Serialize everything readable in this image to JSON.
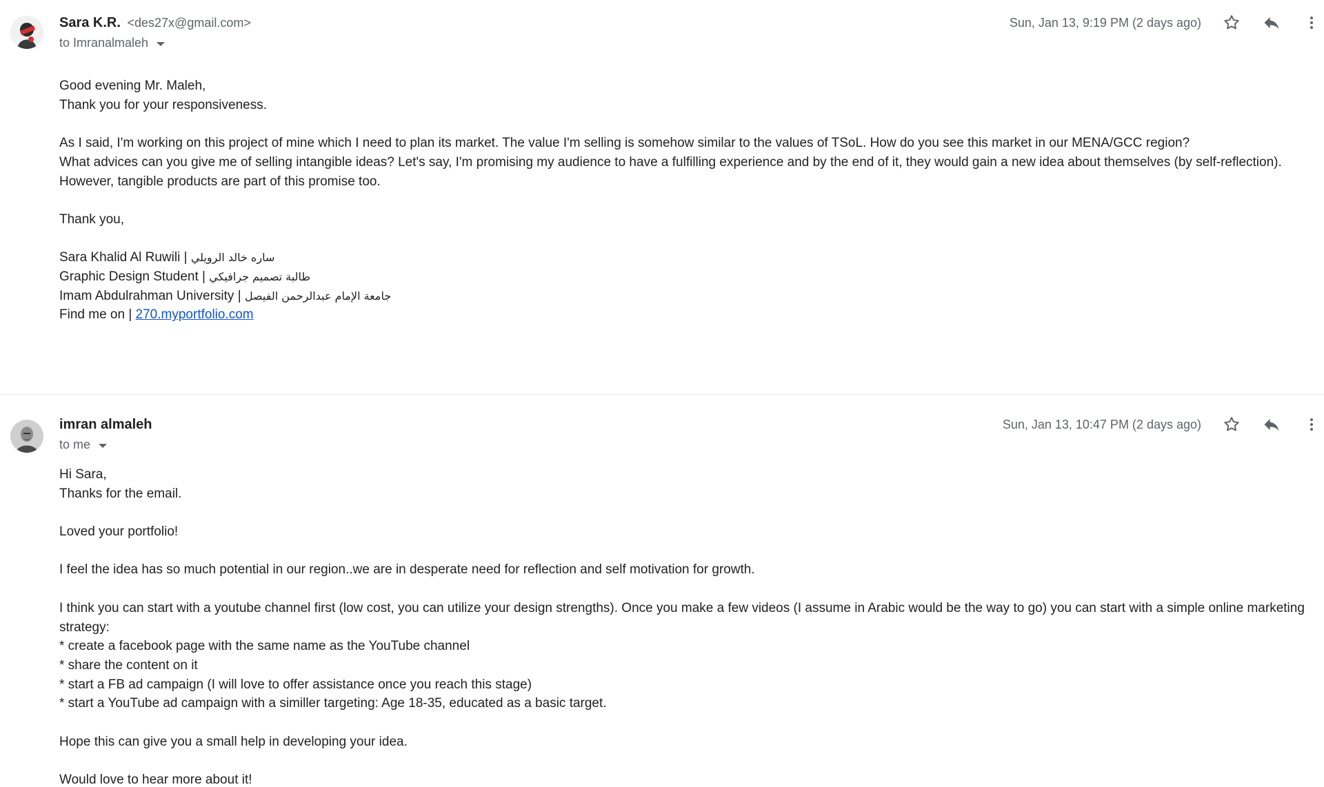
{
  "messages": [
    {
      "sender_name": "Sara K.R.",
      "sender_email": "<des27x@gmail.com>",
      "recipient": "to Imranalmaleh",
      "date": "Sun, Jan 13, 9:19 PM (2 days ago)",
      "avatar_icon": "avatar-illustration",
      "body": {
        "l1": "Good evening Mr. Maleh,",
        "l2": "Thank you for your responsiveness.",
        "l3": "As I said, I'm working on this project of mine which I need to plan its market. The value I'm selling is somehow similar to the values of TSoL. How do you see this market in our MENA/GCC region?",
        "l4": "What advices can you give me of selling intangible ideas? Let's say, I'm promising my audience to have a fulfilling experience and by the end of it, they would gain a new idea about themselves (by self-reflection).",
        "l5": "However, tangible products are part of this promise too.",
        "l6": "Thank you,",
        "sig_name_en": "Sara Khalid Al Ruwili | ",
        "sig_name_ar": "ساره خالد الرويلي",
        "sig_title_en": "Graphic Design Student | ",
        "sig_title_ar": "طالبة تصميم جرافيكي",
        "sig_uni_en": "Imam Abdulrahman University | ",
        "sig_uni_ar": "جامعة الإمام عبدالرحمن الفيصل",
        "find_label": "Find me on | ",
        "find_link": "270.myportfolio.com"
      }
    },
    {
      "sender_name": "imran almaleh",
      "recipient": "to me",
      "date": "Sun, Jan 13, 10:47 PM (2 days ago)",
      "avatar_icon": "avatar-photo",
      "body": {
        "l1": "Hi Sara,",
        "l2": "Thanks for the email.",
        "l3": "Loved your portfolio!",
        "l4": "I feel the idea has so much potential in our region..we are in desperate need for reflection and self motivation for growth.",
        "l5": "I think you can start with a youtube channel first (low cost, you can utilize your design strengths). Once you make a few videos (I assume in Arabic would be the way to go) you can start with a simple online marketing strategy:",
        "l6": "* create a facebook page with the same name as the YouTube channel",
        "l7": "* share the content on it",
        "l8": "* start a FB ad campaign (I will love to offer assistance once you reach this stage)",
        "l9": "* start a YouTube ad campaign with a similler targeting: Age 18-35, educated as a basic target.",
        "l10": "Hope this can give you a small help in developing your idea.",
        "l11": "Would love to hear more about it!"
      }
    }
  ],
  "icons": {
    "star": "star-icon",
    "reply": "reply-icon",
    "more": "more-vert-icon",
    "dropdown": "chevron-down-icon"
  },
  "colors": {
    "link": "#1155cc",
    "secondary_text": "#5f6368",
    "divider": "#e9e9e9"
  }
}
